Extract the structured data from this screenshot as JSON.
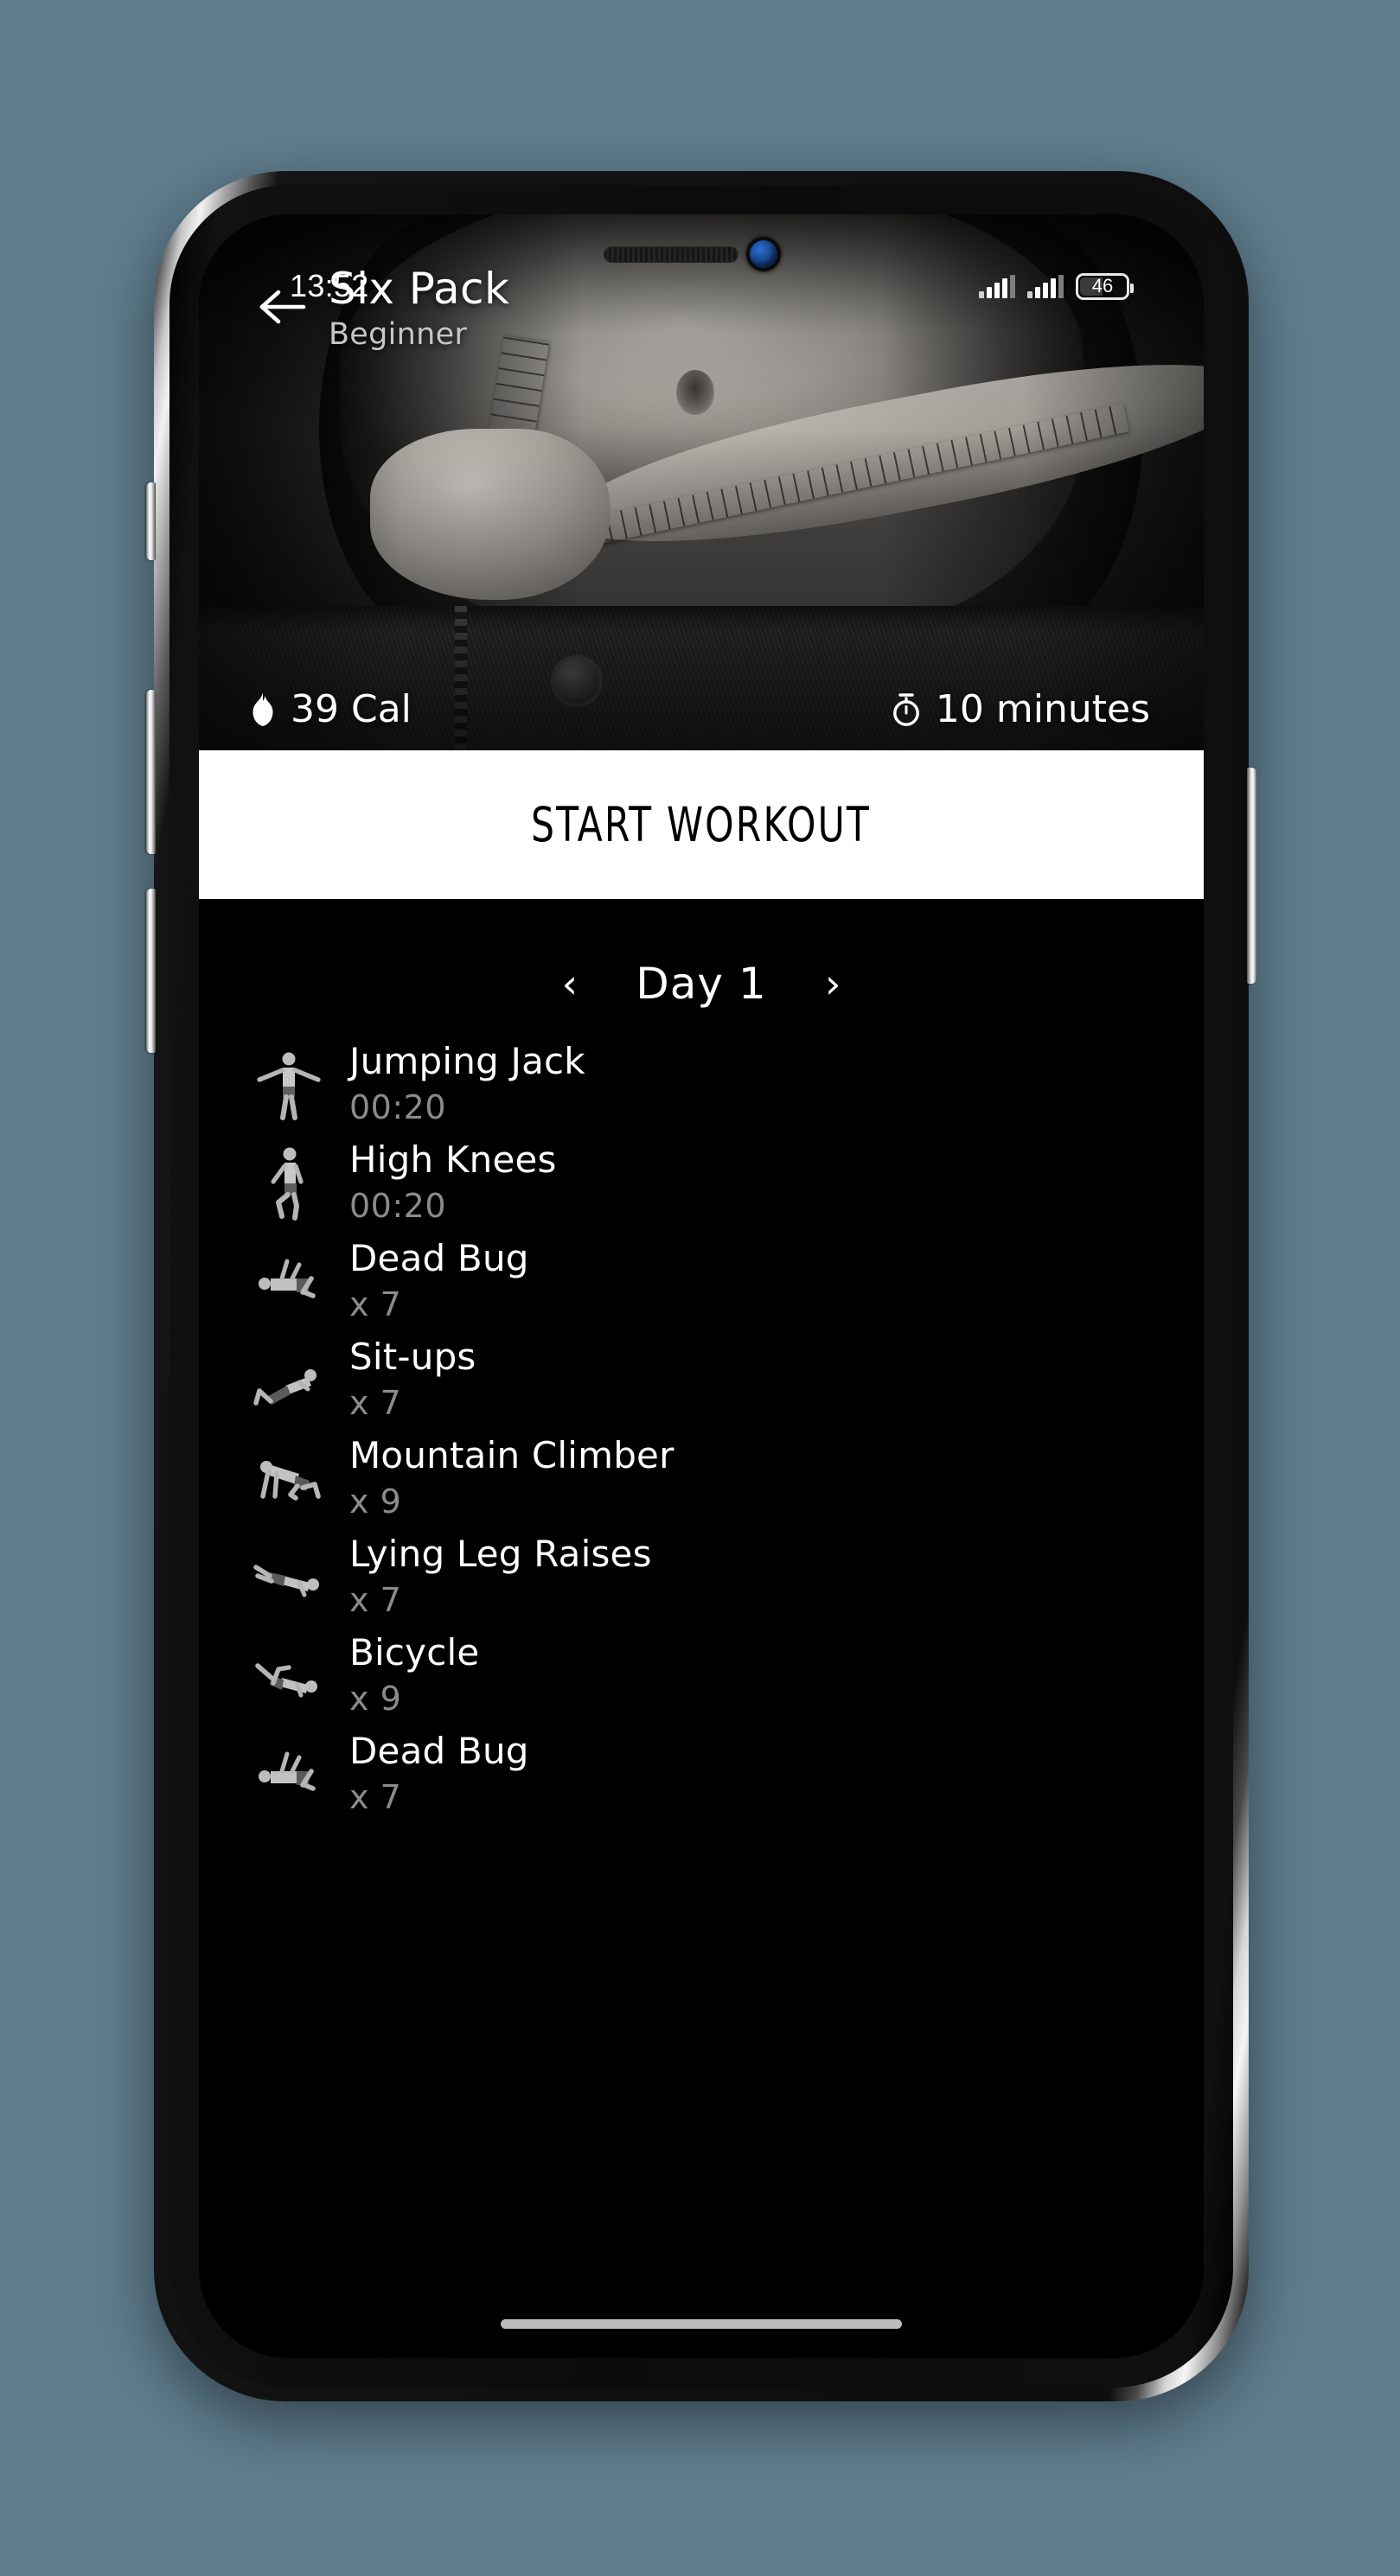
{
  "device": {
    "status_bar": {
      "time": "13:52",
      "signal_1_icon": "cellular-signal-icon",
      "signal_2_icon": "cellular-signal-icon",
      "battery_icon": "battery-icon",
      "battery_level": "46"
    },
    "hardware": {
      "speaker_icon": "earpiece-speaker-icon",
      "camera_icon": "front-camera-icon",
      "mute_switch": "mute-switch",
      "volume_up": "volume-up-button",
      "volume_down": "volume-down-button",
      "power": "power-button",
      "home_indicator": "home-indicator"
    },
    "background_color": "#5f7d8d"
  },
  "app": {
    "theme": {
      "background": "#000000",
      "accent": "#ffffff",
      "muted_text": "#8b8b8b"
    },
    "header": {
      "back_icon": "back-arrow-icon",
      "title": "Six Pack",
      "subtitle": "Beginner"
    },
    "hero": {
      "image_description": "grayscale photo of a person measuring waist with a tape measure",
      "stats": [
        {
          "icon": "flame-icon",
          "value": "39 Cal"
        },
        {
          "icon": "stopwatch-icon",
          "value": "10 minutes"
        }
      ]
    },
    "start_button": {
      "label": "START WORKOUT"
    },
    "day_nav": {
      "prev_icon": "chevron-left-icon",
      "label": "Day 1",
      "next_icon": "chevron-right-icon"
    },
    "exercises": [
      {
        "name": "Jumping Jack",
        "meta": "00:20",
        "pose": "jumping-jack"
      },
      {
        "name": "High Knees",
        "meta": "00:20",
        "pose": "high-knees"
      },
      {
        "name": "Dead Bug",
        "meta": "x 7",
        "pose": "dead-bug"
      },
      {
        "name": "Sit-ups",
        "meta": "x 7",
        "pose": "sit-ups"
      },
      {
        "name": "Mountain Climber",
        "meta": "x 9",
        "pose": "mountain-climber"
      },
      {
        "name": "Lying Leg Raises",
        "meta": "x 7",
        "pose": "lying-leg-raises"
      },
      {
        "name": "Bicycle",
        "meta": "x 9",
        "pose": "bicycle"
      },
      {
        "name": "Dead Bug",
        "meta": "x 7",
        "pose": "dead-bug"
      }
    ]
  }
}
